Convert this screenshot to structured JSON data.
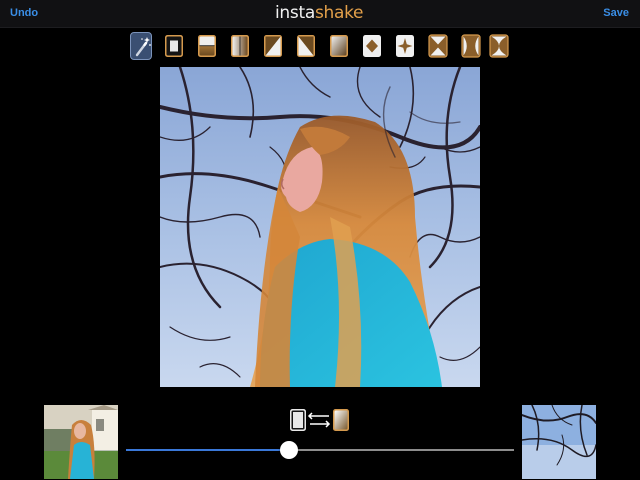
{
  "topbar": {
    "undo_label": "Undo",
    "save_label": "Save",
    "logo_part1": "insta",
    "logo_part2": "shake"
  },
  "tools": [
    {
      "icon": "magic-wand-icon",
      "active": true
    },
    {
      "icon": "frame-center-icon"
    },
    {
      "icon": "split-horizontal-icon"
    },
    {
      "icon": "split-vertical-icon"
    },
    {
      "icon": "diagonal-left-icon"
    },
    {
      "icon": "diagonal-right-icon"
    },
    {
      "icon": "gradient-frame-icon"
    },
    {
      "icon": "diamond-icon"
    },
    {
      "icon": "star-icon"
    },
    {
      "icon": "x-cross-icon"
    },
    {
      "icon": "concave-sides-icon"
    },
    {
      "icon": "hourglass-icon"
    }
  ],
  "blend_slider": {
    "value": 0.42
  },
  "colors": {
    "accent": "#3a8ee6",
    "logo_orange": "#e3a04a",
    "tool_gold": "#d59a4e",
    "slider_fill": "#3a78d8",
    "sky": "#9fb8df",
    "jacket": "#23b6d8",
    "hair": "#c77a32"
  }
}
